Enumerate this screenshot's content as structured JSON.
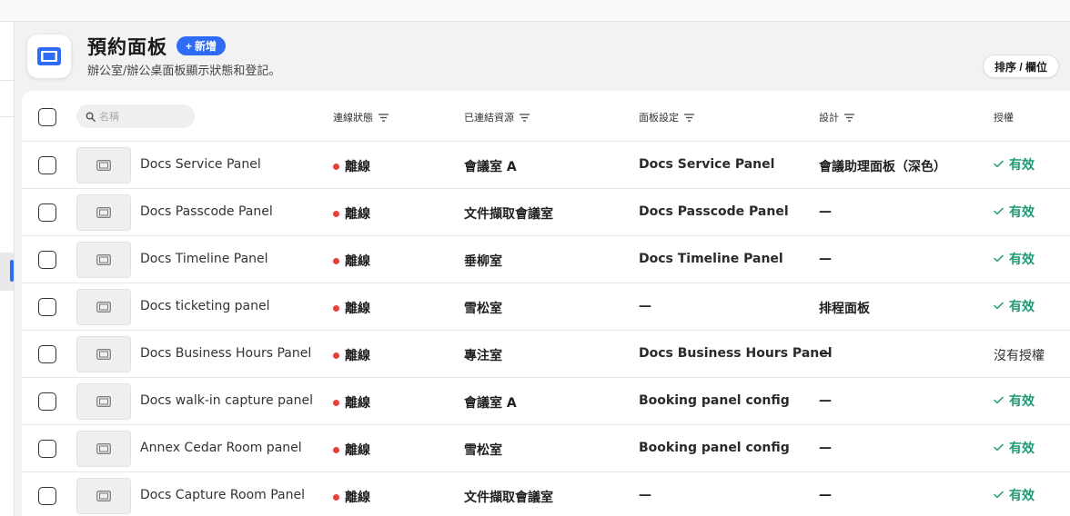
{
  "header": {
    "title": "預約面板",
    "add_label": "新增",
    "subtitle": "辦公室/辦公桌面板顯示狀態和登記。",
    "sort_label": "排序 / 欄位",
    "icon": "panel-icon"
  },
  "table": {
    "search_placeholder": "名稱",
    "columns": {
      "status": "連線狀態",
      "resource": "已連結資源",
      "config": "面板設定",
      "design": "設計",
      "license": "授權"
    },
    "rows": [
      {
        "name": "Docs Service Panel",
        "status": "離線",
        "resource": "會議室 A",
        "config": "Docs Service Panel",
        "design": "會議助理面板（深色）",
        "license": "有效",
        "license_valid": true
      },
      {
        "name": "Docs Passcode Panel",
        "status": "離線",
        "resource": "文件擷取會議室",
        "config": "Docs Passcode Panel",
        "design": "—",
        "license": "有效",
        "license_valid": true
      },
      {
        "name": "Docs Timeline Panel",
        "status": "離線",
        "resource": "垂柳室",
        "config": "Docs Timeline Panel",
        "design": "—",
        "license": "有效",
        "license_valid": true
      },
      {
        "name": "Docs ticketing panel",
        "status": "離線",
        "resource": "雪松室",
        "config": "—",
        "design": "排程面板",
        "license": "有效",
        "license_valid": true
      },
      {
        "name": "Docs Business Hours Panel",
        "status": "離線",
        "resource": "專注室",
        "config": "Docs Business Hours Panel",
        "design": "—",
        "license": "沒有授權",
        "license_valid": false
      },
      {
        "name": "Docs walk-in capture panel",
        "status": "離線",
        "resource": "會議室 A",
        "config": "Booking panel config",
        "design": "—",
        "license": "有效",
        "license_valid": true
      },
      {
        "name": "Annex Cedar Room panel",
        "status": "離線",
        "resource": "雪松室",
        "config": "Booking panel config",
        "design": "—",
        "license": "有效",
        "license_valid": true
      },
      {
        "name": "Docs Capture Room Panel",
        "status": "離線",
        "resource": "文件擷取會議室",
        "config": "—",
        "design": "—",
        "license": "有效",
        "license_valid": true
      }
    ]
  },
  "colors": {
    "accent": "#2f6cf6",
    "offline": "#e8403c",
    "valid": "#1e9a75"
  }
}
